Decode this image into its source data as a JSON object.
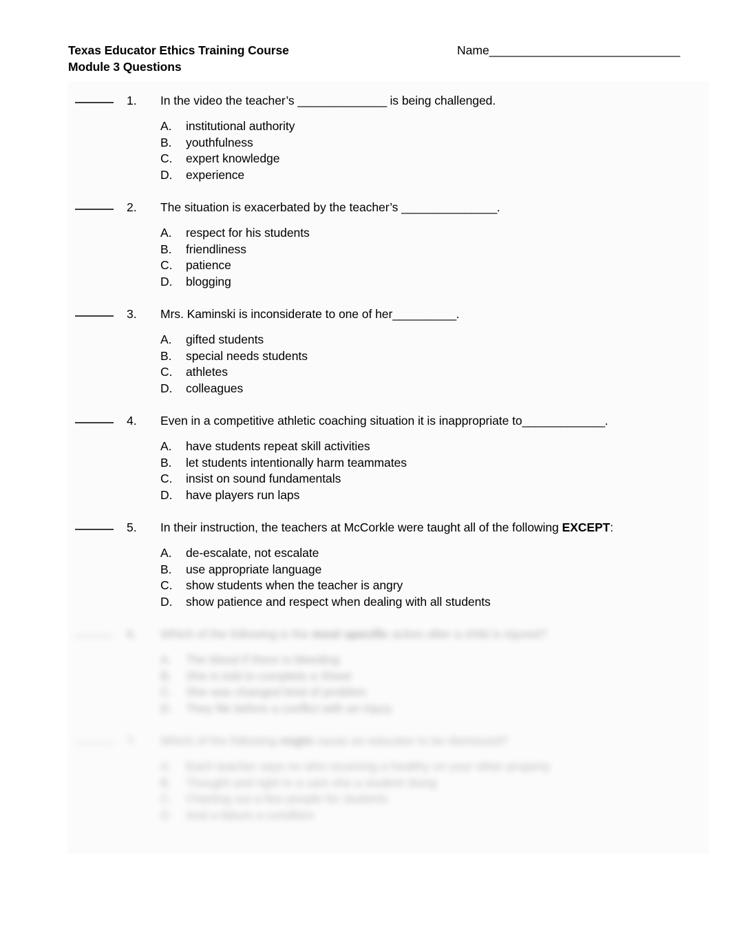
{
  "document": {
    "course_title": "Texas Educator Ethics Training Course",
    "module_title": "Module 3 Questions",
    "name_label": "Name",
    "name_rule": "______________________________"
  },
  "questions": [
    {
      "number": "1.",
      "blank": "______",
      "text_before": "In the video the teacher’s ",
      "inline_blank": "______________",
      "text_after": " is being challenged.",
      "emphasis": "",
      "options": [
        {
          "letter": "A.",
          "text": "institutional authority"
        },
        {
          "letter": "B.",
          "text": "youthfulness"
        },
        {
          "letter": "C.",
          "text": "expert knowledge"
        },
        {
          "letter": "D.",
          "text": "experience"
        }
      ]
    },
    {
      "number": "2.",
      "blank": "______",
      "text_before": "The situation is exacerbated by the teacher’s ",
      "inline_blank": "_______________",
      "text_after": ".",
      "emphasis": "",
      "options": [
        {
          "letter": "A.",
          "text": "respect for his students"
        },
        {
          "letter": "B.",
          "text": "friendliness"
        },
        {
          "letter": "C.",
          "text": "patience"
        },
        {
          "letter": "D.",
          "text": "blogging"
        }
      ]
    },
    {
      "number": "3.",
      "blank": "______",
      "text_before": "Mrs. Kaminski is inconsiderate to one of her",
      "inline_blank": "__________",
      "text_after": ".",
      "emphasis": "",
      "options": [
        {
          "letter": "A.",
          "text": "gifted students"
        },
        {
          "letter": "B.",
          "text": "special needs students"
        },
        {
          "letter": "C.",
          "text": "athletes"
        },
        {
          "letter": "D.",
          "text": "colleagues"
        }
      ]
    },
    {
      "number": "4.",
      "blank": "______",
      "text_before": "Even in a competitive athletic coaching situation it is inappropriate to",
      "inline_blank": "_____________",
      "text_after": ".",
      "emphasis": "",
      "options": [
        {
          "letter": "A.",
          "text": "have students repeat skill activities"
        },
        {
          "letter": "B.",
          "text": "let students intentionally harm teammates"
        },
        {
          "letter": "C.",
          "text": "insist on sound fundamentals"
        },
        {
          "letter": "D.",
          "text": "have players run laps"
        }
      ]
    },
    {
      "number": "5.",
      "blank": "______",
      "text_before": "In their instruction, the teachers at McCorkle were taught all of the following ",
      "inline_blank": "",
      "emphasis": "EXCEPT",
      "text_after": ":",
      "options": [
        {
          "letter": "A.",
          "text": "de-escalate, not escalate"
        },
        {
          "letter": "B.",
          "text": "use appropriate language"
        },
        {
          "letter": "C.",
          "text": "show students when the teacher is angry"
        },
        {
          "letter": "D.",
          "text": "show patience and respect when dealing with all students"
        }
      ]
    },
    {
      "number": "6.",
      "blank": "______",
      "blurred": true,
      "text_before": "Which of the following is the ",
      "inline_blank": "",
      "emphasis": "most specific",
      "text_after": " action after a child is injured?",
      "options": [
        {
          "letter": "A.",
          "text": "The blood if there is bleeding"
        },
        {
          "letter": "B.",
          "text": "She is told to complete a Sheet"
        },
        {
          "letter": "C.",
          "text": "She was changed kind of problem"
        },
        {
          "letter": "D.",
          "text": "They file before a conflict with an injury"
        }
      ]
    },
    {
      "number": "7.",
      "blank": "______",
      "blurred": true,
      "text_before": "Which of the following ",
      "inline_blank": "",
      "emphasis": "might",
      "text_after": " cause an educator to be dismissed?",
      "options": [
        {
          "letter": "A.",
          "text": "Each teacher says no who receiving a healthy on your other property"
        },
        {
          "letter": "B.",
          "text": "Thought and right in a care she a student doing"
        },
        {
          "letter": "C.",
          "text": "Charting out a few people for students"
        },
        {
          "letter": "D.",
          "text": "And a failure a condition"
        }
      ]
    }
  ]
}
